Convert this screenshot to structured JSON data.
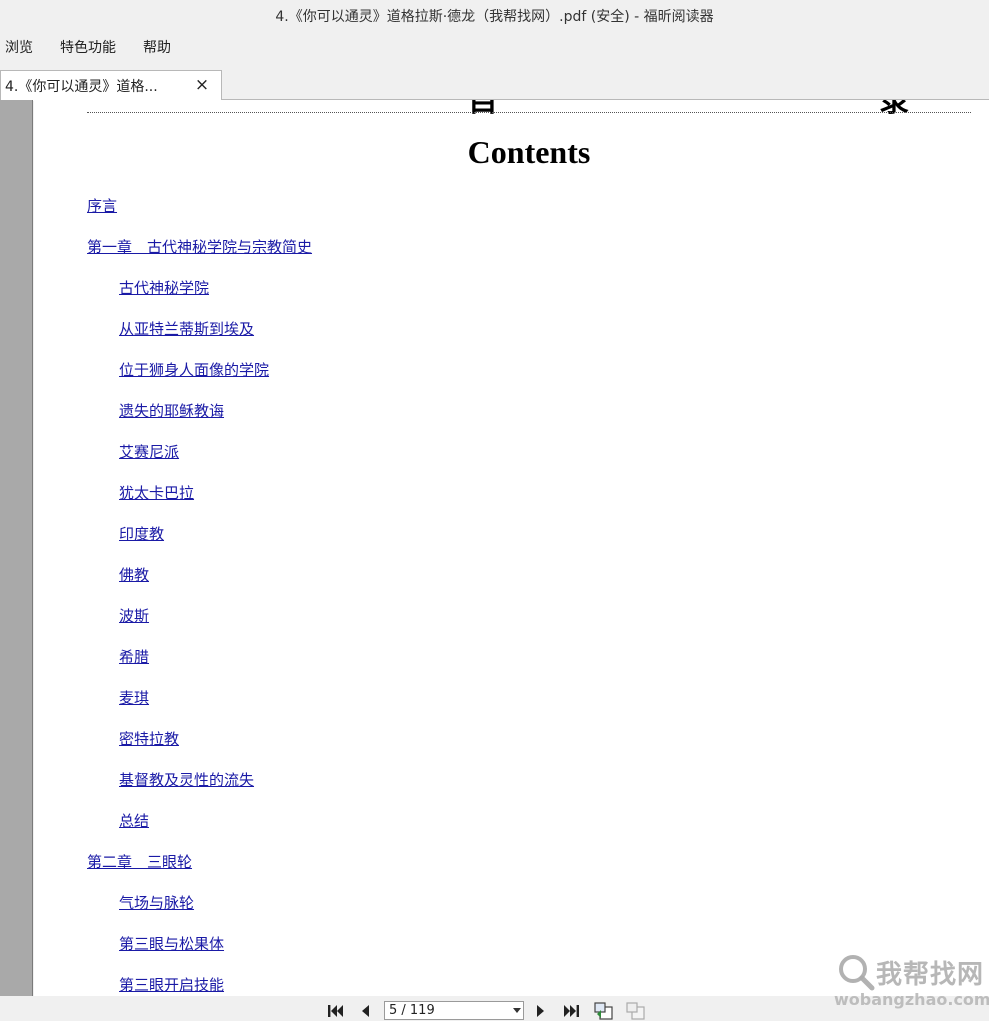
{
  "window": {
    "title": "4.《你可以通灵》道格拉斯·德龙（我帮找网）.pdf (安全) - 福昕阅读器"
  },
  "menu": {
    "items": [
      "浏览",
      "特色功能",
      "帮助"
    ]
  },
  "tab": {
    "label": "4.《你可以通灵》道格...",
    "close": "×"
  },
  "document": {
    "heading_clipped_glyphs": [
      "目",
      "录"
    ],
    "contents_title": "Contents",
    "toc": [
      {
        "label": "序言",
        "level": 1
      },
      {
        "label": "第一章　古代神秘学院与宗教简史",
        "level": 1
      },
      {
        "label": "古代神秘学院",
        "level": 2
      },
      {
        "label": "从亚特兰蒂斯到埃及",
        "level": 2
      },
      {
        "label": "位于狮身人面像的学院",
        "level": 2
      },
      {
        "label": "遗失的耶稣教诲",
        "level": 2
      },
      {
        "label": "艾赛尼派",
        "level": 2
      },
      {
        "label": "犹太卡巴拉",
        "level": 2
      },
      {
        "label": "印度教",
        "level": 2
      },
      {
        "label": "佛教",
        "level": 2
      },
      {
        "label": "波斯",
        "level": 2
      },
      {
        "label": "希腊",
        "level": 2
      },
      {
        "label": "麦琪",
        "level": 2
      },
      {
        "label": "密特拉教",
        "level": 2
      },
      {
        "label": "基督教及灵性的流失",
        "level": 2
      },
      {
        "label": "总结",
        "level": 2
      },
      {
        "label": "第二章　三眼轮",
        "level": 1
      },
      {
        "label": "气场与脉轮",
        "level": 2
      },
      {
        "label": "第三眼与松果体",
        "level": 2
      },
      {
        "label": "第三眼开启技能",
        "level": 2
      }
    ]
  },
  "status": {
    "page_indicator": "5 / 119"
  },
  "watermark": {
    "cn": "我帮找网",
    "en": "wobangzhao.com"
  },
  "colors": {
    "link": "#1a1aa6",
    "chrome": "#f0f0f0",
    "gutter": "#a9a9a9"
  }
}
